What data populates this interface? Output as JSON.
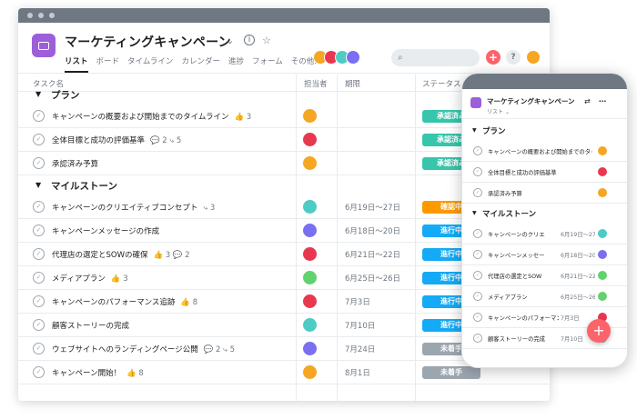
{
  "project": {
    "title": "マーケティングキャンペーン",
    "tabs": [
      "リスト",
      "ボード",
      "タイムライン",
      "カレンダー",
      "進捗",
      "フォーム",
      "その他..."
    ]
  },
  "header_icons": [
    "chevron-down-icon",
    "info-icon",
    "star-icon",
    "search-icon",
    "plus-icon",
    "help-icon"
  ],
  "header_buttons": {
    "plus": "+",
    "help": "?"
  },
  "columns": {
    "task": "タスク名",
    "assignee": "担当者",
    "due": "期限",
    "status": "ステータス"
  },
  "colors": {
    "accent": "#9c5fd9",
    "add_button": "#fc636b",
    "approved": "#37c5ab",
    "confirming": "#fd9a00",
    "in_progress": "#14aaf5",
    "not_started": "#9ca6af"
  },
  "sections": [
    {
      "name": "プラン",
      "tasks": [
        {
          "name": "キャンペーンの概要および開始までのタイムライン",
          "meta": "👍 3",
          "due": "",
          "status": "承認済み",
          "avatar": "#f5a623"
        },
        {
          "name": "全体目標と成功の評価基準",
          "meta": "💬 2   ⤷ 5",
          "due": "",
          "status": "承認済み",
          "avatar": "#e8384f"
        },
        {
          "name": "承認済み予算",
          "meta": "",
          "due": "",
          "status": "承認済み",
          "avatar": "#f5a623"
        }
      ]
    },
    {
      "name": "マイルストーン",
      "tasks": [
        {
          "name": "キャンペーンのクリエイティブコンセプト",
          "meta": "⤷ 3",
          "due": "6月19日〜27日",
          "status": "確認中",
          "avatar": "#4ecbc4"
        },
        {
          "name": "キャンペーンメッセージの作成",
          "meta": "",
          "due": "6月18日〜20日",
          "status": "進行中",
          "avatar": "#7a6ff0"
        },
        {
          "name": "代理店の選定とSOWの確保",
          "meta": "👍 3   💬 2",
          "due": "6月21日〜22日",
          "status": "進行中",
          "avatar": "#e8384f"
        },
        {
          "name": "メディアプラン",
          "meta": "👍 3",
          "due": "6月25日〜26日",
          "status": "進行中",
          "avatar": "#62d26f"
        },
        {
          "name": "キャンペーンのパフォーマンス追跡",
          "meta": "👍 8",
          "due": "7月3日",
          "status": "進行中",
          "avatar": "#e8384f"
        },
        {
          "name": "顧客ストーリーの完成",
          "meta": "",
          "due": "7月10日",
          "status": "進行中",
          "avatar": "#4ecbc4"
        },
        {
          "name": "ウェブサイトへのランディングページ公開",
          "meta": "💬 2   ⤷ 5",
          "due": "7月24日",
          "status": "未着手",
          "avatar": "#7a6ff0"
        },
        {
          "name": "キャンペーン開始！",
          "meta": "👍 8",
          "due": "8月1日",
          "status": "未着手",
          "avatar": "#f5a623"
        }
      ]
    }
  ],
  "mobile": {
    "title": "マーケティングキャンペーン",
    "view": "リスト",
    "fab": "+",
    "sections": [
      {
        "name": "プラン",
        "tasks": [
          {
            "name": "キャンペーンの概要および開始までのタイ",
            "due": "",
            "avatar": "#f5a623"
          },
          {
            "name": "全体目標と成功の評価基準",
            "due": "",
            "avatar": "#e8384f"
          },
          {
            "name": "承認済み予算",
            "due": "",
            "avatar": "#f5a623"
          }
        ]
      },
      {
        "name": "マイルストーン",
        "tasks": [
          {
            "name": "キャンペーンのクリエ",
            "due": "6月19日〜27日",
            "avatar": "#4ecbc4"
          },
          {
            "name": "キャンペーンメッセー",
            "due": "6月18日〜20日",
            "avatar": "#7a6ff0"
          },
          {
            "name": "代理店の選定とSOW",
            "due": "6月21日〜22日",
            "avatar": "#62d26f"
          },
          {
            "name": "メディアプラン",
            "due": "6月25日〜26日",
            "avatar": "#62d26f"
          },
          {
            "name": "キャンペーンのパフォーマンス",
            "due": "7月3日",
            "avatar": "#e8384f"
          },
          {
            "name": "顧客ストーリーの完成",
            "due": "7月10日",
            "avatar": "#4ecbc4"
          }
        ]
      }
    ]
  }
}
